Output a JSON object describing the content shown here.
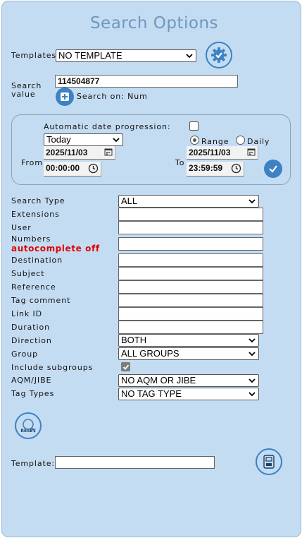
{
  "title": "Search Options",
  "templates": {
    "label": "Templates",
    "value": "NO TEMPLATE"
  },
  "search": {
    "label_line1": "Search",
    "label_line2": "value",
    "value": "114504877",
    "search_on": "Search on: Num"
  },
  "dates": {
    "auto_label": "Automatic date progression:",
    "preset": "Today",
    "from_label": "From",
    "to_label": "To",
    "from_date": "2025/11/03",
    "from_time": "00:00:00",
    "to_date": "2025/11/03",
    "to_time": "23:59:59",
    "range_label": "Range",
    "daily_label": "Daily"
  },
  "fields": {
    "search_type": "Search Type",
    "search_type_value": "ALL",
    "extensions": "Extensions",
    "user": "User",
    "numbers": "Numbers",
    "autocomplete": "autocomplete off",
    "destination": "Destination",
    "subject": "Subject",
    "reference": "Reference",
    "tag_comment": "Tag comment",
    "link_id": "Link ID",
    "duration": "Duration",
    "direction": "Direction",
    "direction_value": "BOTH",
    "group": "Group",
    "group_value": "ALL GROUPS",
    "include_subgroups": "Include subgroups",
    "aqm": "AQM/JIBE",
    "aqm_value": "NO AQM OR JIBE",
    "tag_types": "Tag Types",
    "tag_types_value": "NO TAG TYPE"
  },
  "reset_label": "RESET",
  "template_save": {
    "label": "Template:",
    "value": ""
  },
  "colors": {
    "panel": "#c4dcf2",
    "accent": "#3c82c4",
    "title": "#6f97be",
    "warning": "#e00000"
  },
  "icons": [
    "gear-icon",
    "plus-icon",
    "calendar-icon",
    "clock-icon",
    "checkmark-icon",
    "reset-icon",
    "save-icon"
  ]
}
